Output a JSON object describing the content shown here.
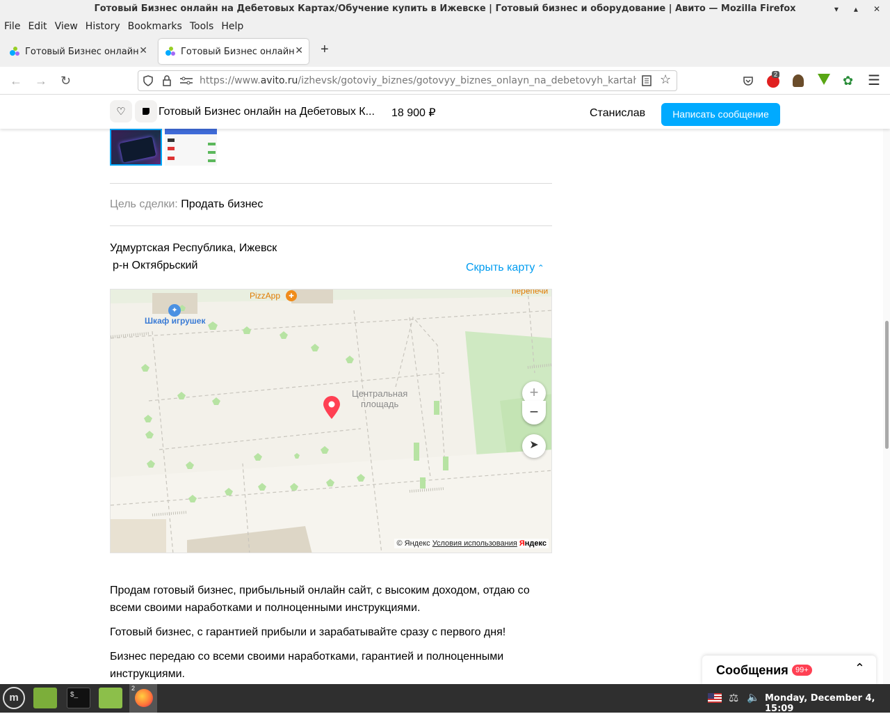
{
  "window": {
    "title": "Готовый Бизнес онлайн на Дебетовых Картах/Обучение купить в Ижевске | Готовый бизнес и оборудование | Авито — Mozilla Firefox"
  },
  "menu": [
    "File",
    "Edit",
    "View",
    "History",
    "Bookmarks",
    "Tools",
    "Help"
  ],
  "tabs": [
    {
      "label": "Готовый Бизнес онлайн на Д"
    },
    {
      "label": "Готовый Бизнес онлайн на Д"
    }
  ],
  "urlbar": {
    "prefix": "https://www.",
    "domain": "avito.ru",
    "path": "/izhevsk/gotoviy_biznes/gotovyy_biznes_onlayn_na_debetovyh_kartahobuchenie"
  },
  "extensions": {
    "badge": "2"
  },
  "header": {
    "title": "Готовый Бизнес онлайн на Дебетовых К...",
    "price": "18 900 ₽",
    "seller": "Станислав",
    "write_button": "Написать сообщение"
  },
  "listing": {
    "goal_label": "Цель сделки:",
    "goal_value": "Продать бизнес",
    "address_line1": "Удмуртская Республика, Ижевск",
    "address_line2": "р-н Октябрьский",
    "hide_map": "Скрыть карту"
  },
  "map": {
    "labels": {
      "pizza": "PizzApp",
      "toys": "Шкаф игрушек",
      "square1": "Центральная",
      "square2": "площадь",
      "corner": "перепечи"
    },
    "copyright": "© Яндекс",
    "terms": "Условия использования",
    "logo_y": "Я",
    "logo_rest": "ндекс"
  },
  "description": [
    "Продам готовый бизнес, прибыльный онлайн сайт, с высоким доходом, отдаю со всеми своими наработками и полноценными инструкциями.",
    "Готовый бизнес, с гарантией прибыли и зарабатывайте сразу с первого дня!",
    "Бизнес передаю со всеми своими наработками, гарантией и полноценными инструкциями."
  ],
  "messages": {
    "title": "Сообщения",
    "badge": "99+"
  },
  "taskbar": {
    "clock": "Monday, December  4, 15:09",
    "firefox_count": "2"
  },
  "colors": {
    "accent": "#00aaff",
    "link": "#009cf0",
    "badge": "#ff4053",
    "pin": "#ff4053"
  }
}
